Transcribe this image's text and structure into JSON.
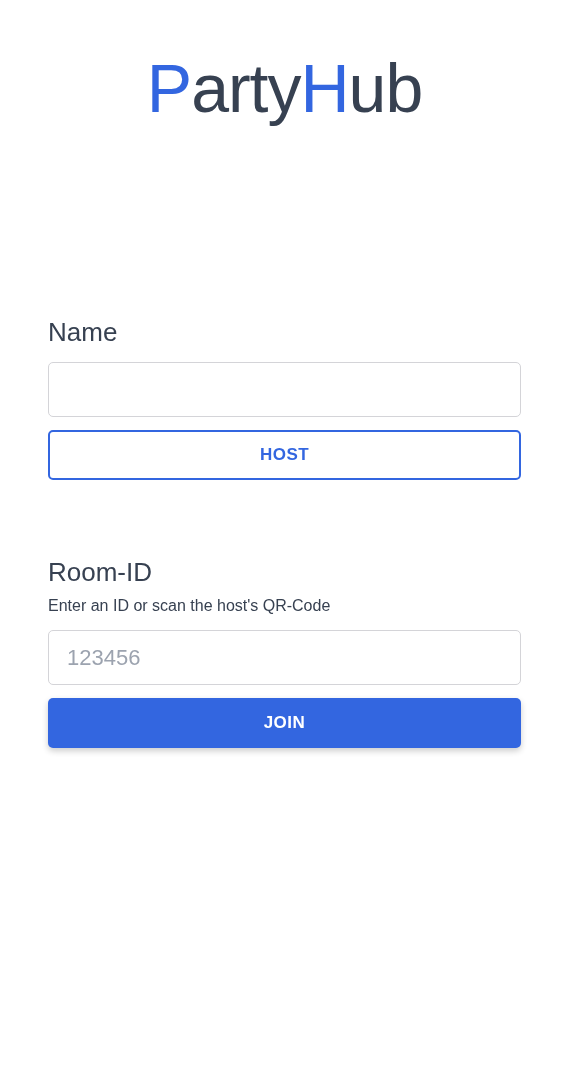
{
  "logo": [
    {
      "text": "P",
      "accent": true
    },
    {
      "text": "arty",
      "accent": false
    },
    {
      "text": "H",
      "accent": true
    },
    {
      "text": "ub",
      "accent": false
    }
  ],
  "name_section": {
    "label": "Name",
    "button": {
      "label": "HOST",
      "kind": "outline"
    }
  },
  "room_section": {
    "label": "Room-ID",
    "hint": "Enter an ID or scan the host's QR-Code",
    "field": {
      "placeholder": "123456"
    },
    "button": {
      "label": "JOIN",
      "kind": "filled"
    }
  }
}
